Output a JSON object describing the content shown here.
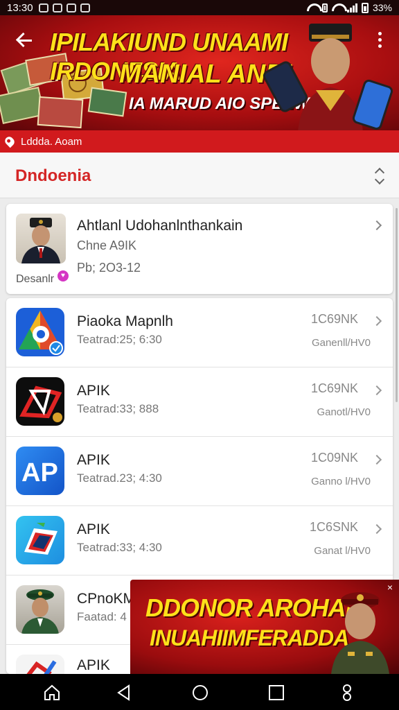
{
  "status": {
    "time": "13:30",
    "battery": "33%"
  },
  "hero": {
    "line1": "IPILAKIUND UNAAMI IRDONFSIA",
    "line2": "MANIAL ANDI",
    "line3": "IA MARUD AIO SPEEW"
  },
  "sub_strip": {
    "label": "Lddda. Aoam"
  },
  "section": {
    "title": "Dndoenia"
  },
  "featured": {
    "title": "Ahtlanl Udohanlnthankain",
    "line1": "Chne A9IK",
    "line2": "Pb; 2O3-12",
    "developer": "Desanlr"
  },
  "apps": [
    {
      "name": "Piaoka Mapnlh",
      "meta": "Teatrad:25; 6:30",
      "size": "1C69NK",
      "tag": "Ganenll/HV0",
      "icon": "map-app-icon"
    },
    {
      "name": "APIK",
      "meta": "Teatrad:33; 888",
      "size": "1C69NK",
      "tag": "Ganotl/HV0",
      "icon": "apik-dark-icon"
    },
    {
      "name": "APIK",
      "meta": "Teatrad.23; 4:30",
      "size": "1C09NK",
      "tag": "Ganno l/HV0",
      "icon": "ap-blue-icon"
    },
    {
      "name": "APIK",
      "meta": "Teatrad:33; 4:30",
      "size": "1C6SNK",
      "tag": "Ganat l/HV0",
      "icon": "apik-cyan-icon"
    },
    {
      "name": "CPnoKM",
      "meta": "Faatad: 4",
      "size": "",
      "tag": "",
      "icon": "officer-icon"
    },
    {
      "name": "APIK",
      "meta": "",
      "size": "",
      "tag": "",
      "icon": "apik-white-icon"
    }
  ],
  "promo": {
    "line1": "DDONOR AROHAN",
    "line2": "INUAHIIMFERADDA",
    "close": "×"
  },
  "colors": {
    "accent_red": "#d11a1d",
    "title_red": "#d42626",
    "banner_yellow": "#ffe11a"
  }
}
